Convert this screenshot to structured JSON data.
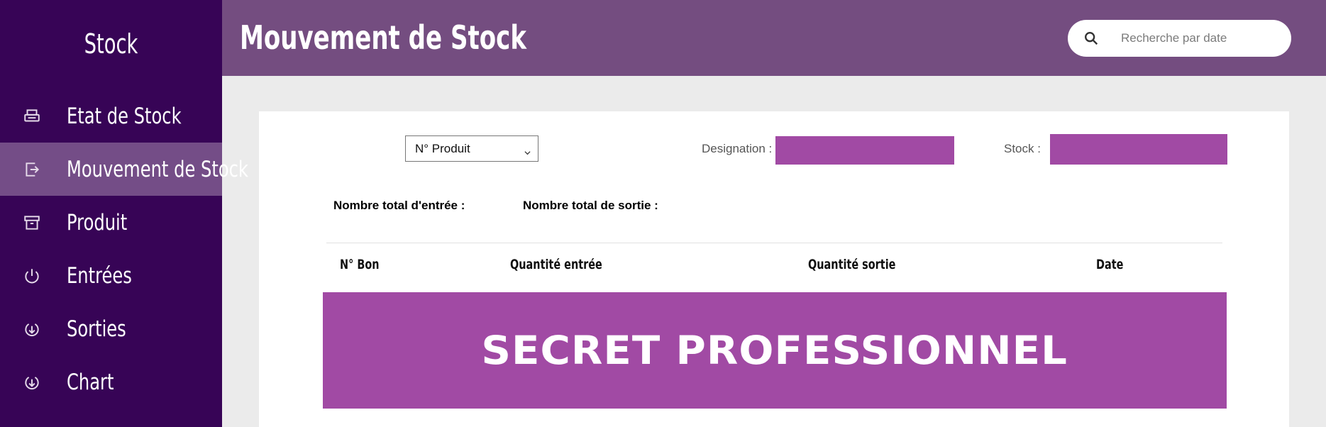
{
  "sidebar": {
    "brand": "Stock",
    "items": [
      {
        "label": "Etat de Stock",
        "icon": "printer-icon"
      },
      {
        "label": "Mouvement de Stock",
        "icon": "export-icon",
        "active": true
      },
      {
        "label": "Produit",
        "icon": "archive-icon"
      },
      {
        "label": "Entrées",
        "icon": "power-icon"
      },
      {
        "label": "Sorties",
        "icon": "download-circle-icon"
      },
      {
        "label": "Chart",
        "icon": "download-circle-icon"
      }
    ]
  },
  "header": {
    "title": "Mouvement de Stock",
    "search_placeholder": "Recherche par date"
  },
  "filters": {
    "product_select": "N° Produit",
    "designation_label": "Designation :",
    "stock_label": "Stock :",
    "total_in_label": "Nombre total d'entrée  :",
    "total_out_label": "Nombre total de sortie :"
  },
  "table": {
    "columns": [
      "N° Bon",
      "Quantité entrée",
      "Quantité sortie",
      "Date"
    ]
  },
  "redaction_text": "SECRET PROFESSIONNEL",
  "colors": {
    "sidebar_bg": "#370456",
    "sidebar_active": "#744d87",
    "header_bg": "#744d80",
    "accent_block": "#a14aa4",
    "page_bg": "#ebebeb"
  }
}
